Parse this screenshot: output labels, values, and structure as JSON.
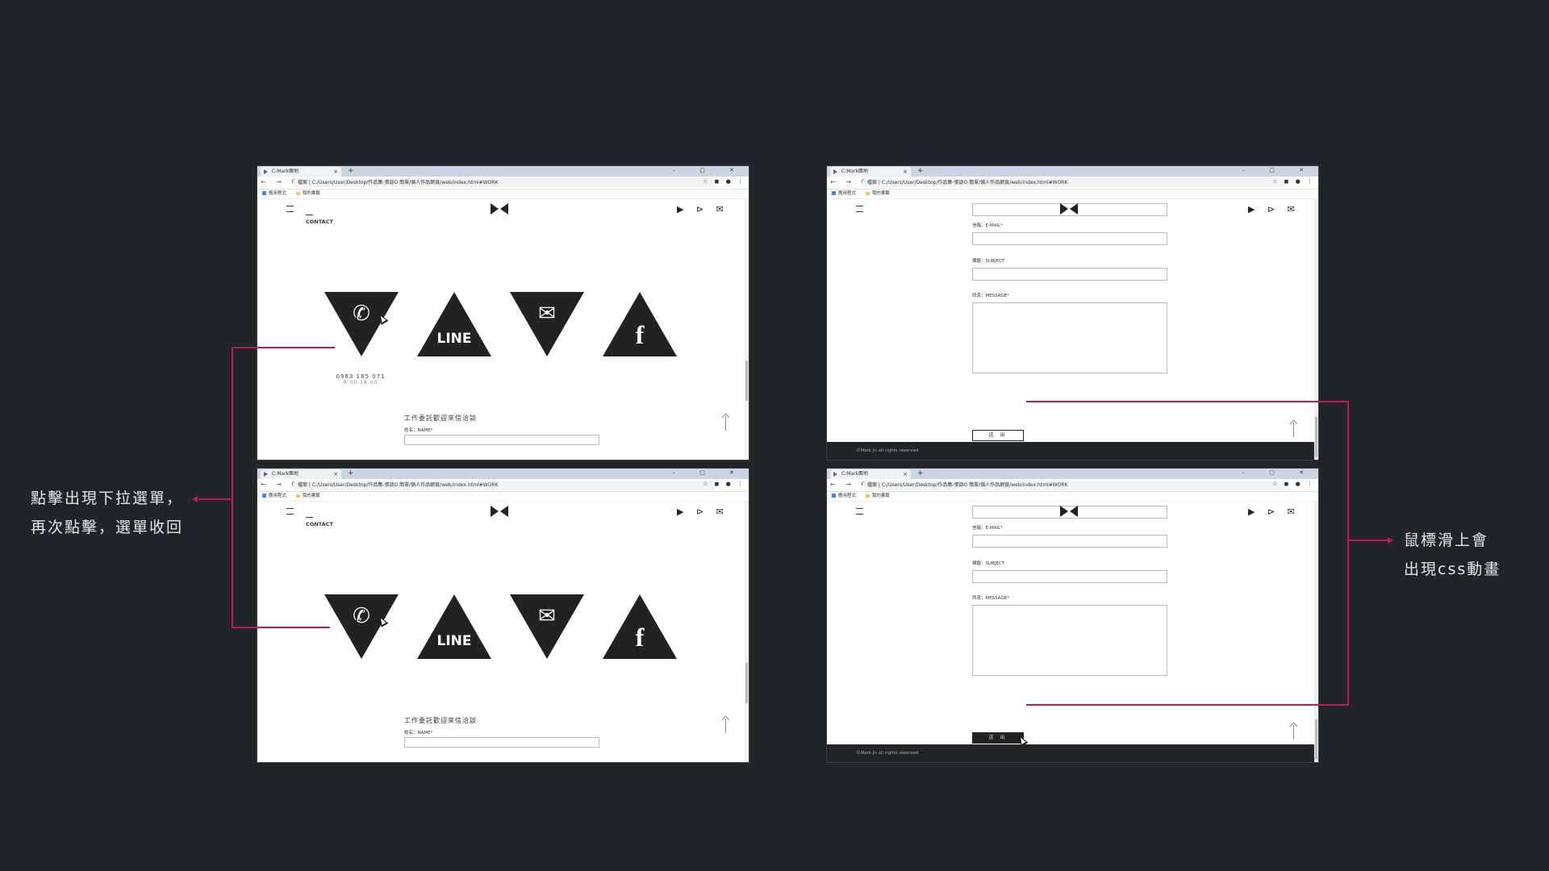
{
  "browser": {
    "tab_title": "C:Mark團地",
    "new_tab": "+",
    "window_controls": "– ▢ ✕",
    "nav_buttons": "← → C",
    "url": "檔案 | C:/Users/User/Desktop/作品集-張劭O 簡單/個人作品網頁/web/index.html#WORK",
    "addr_icons": "☆ ◼ ● ⋮",
    "bookmarks": [
      "應用程式",
      "我的書籤"
    ]
  },
  "site": {
    "top_icons": "▶ ⊳ ✉",
    "contact_heading": "CONTACT",
    "phone_number": "0983 185 071",
    "phone_hours": "9:00-18:00",
    "icons": [
      "phone-icon",
      "line-icon",
      "mail-icon",
      "facebook-icon"
    ],
    "phone_glyph": "✆",
    "line_label": "LINE",
    "mail_glyph": "✉",
    "fb_glyph": "f",
    "form_title": "工作委託歡迎來信洽談",
    "name_label": "姓名：NAME",
    "email_label": "信箱：E-MAIL",
    "subject_label": "標題：SUBJECT",
    "message_label": "訊息：MESSAGE",
    "required_mark": "*",
    "submit_label": "送 出",
    "footer": "©Mark Jn all rights reserved"
  },
  "annotations": {
    "left_line1": "點擊出現下拉選單，",
    "left_line2": "再次點擊，選單收回",
    "right_line1": "鼠標滑上會",
    "right_line2": "出現css動畫"
  },
  "colors": {
    "background": "#212529",
    "accent": "#c2185b"
  }
}
